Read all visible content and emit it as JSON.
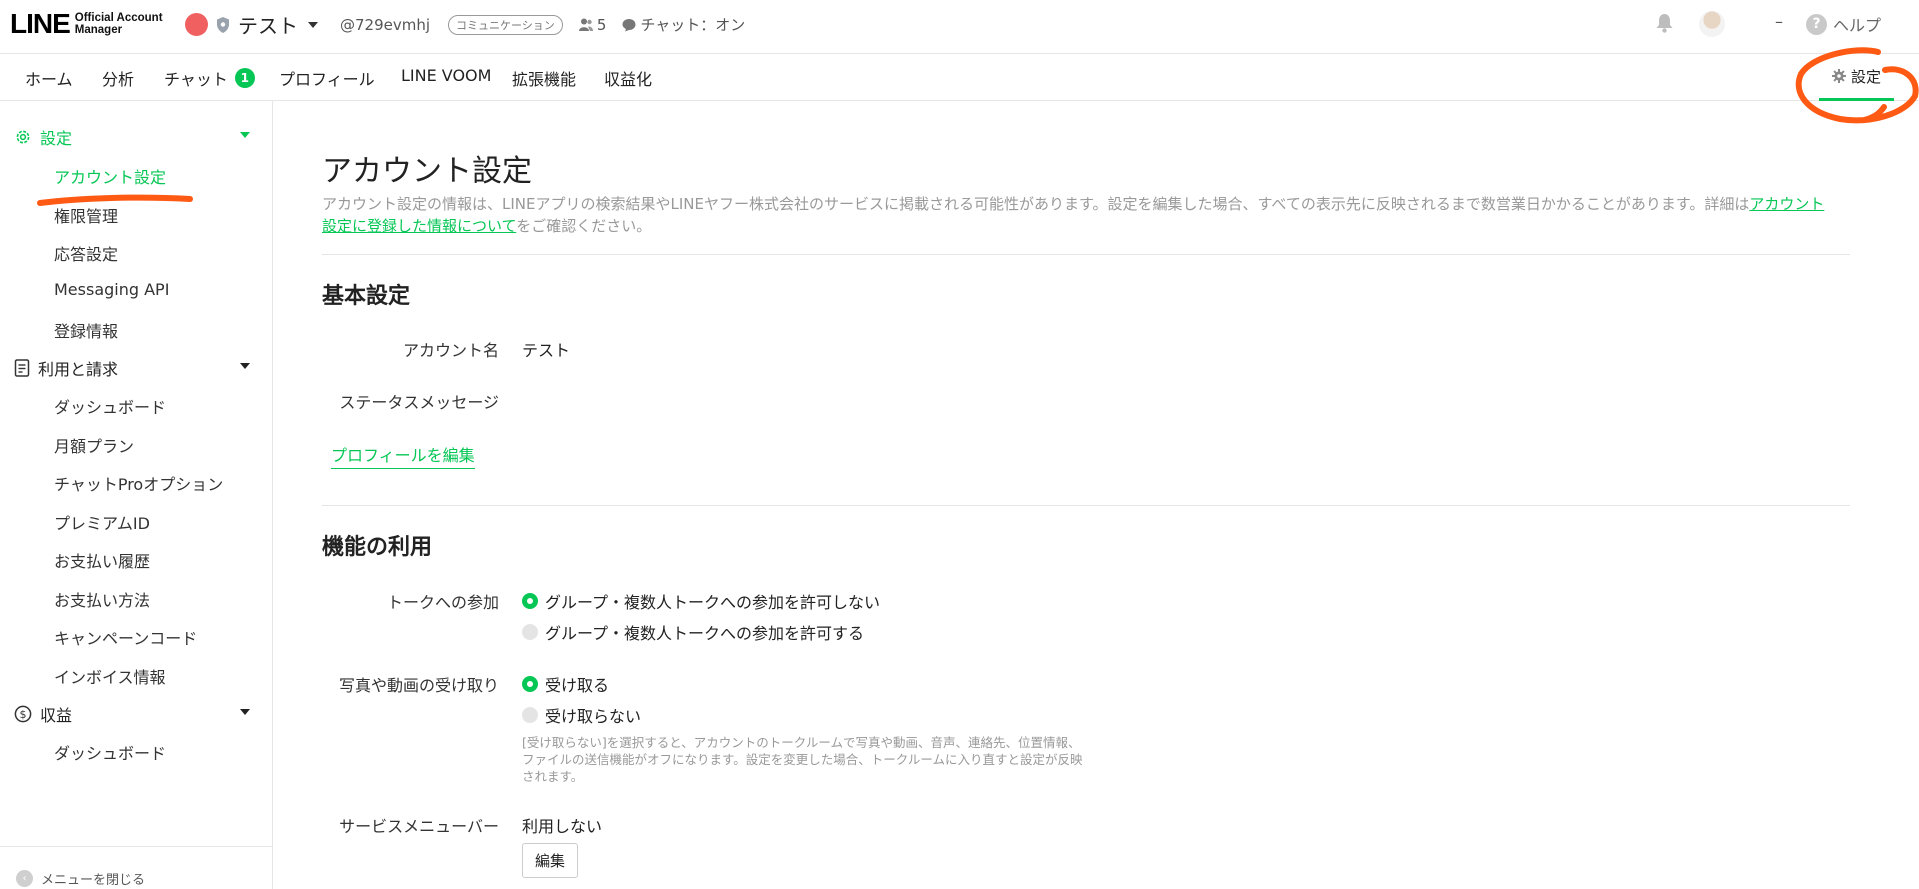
{
  "header": {
    "logo_main": "LINE",
    "logo_sub": "Official Account Manager",
    "account_name": "テスト",
    "account_id": "@729evmhj",
    "plan_badge": "コミュニケーション",
    "friends_count": "5",
    "chat_status": "チャット：オン",
    "dash": "–",
    "help_label": "ヘルプ"
  },
  "nav": {
    "tabs": [
      "ホーム",
      "分析",
      "チャット",
      "プロフィール",
      "LINE VOOM",
      "拡張機能",
      "収益化"
    ],
    "chat_badge": "1",
    "settings_label": "設定"
  },
  "sidebar": {
    "sections": [
      {
        "label": "設定",
        "items": [
          "アカウント設定",
          "権限管理",
          "応答設定",
          "Messaging API",
          "登録情報"
        ]
      },
      {
        "label": "利用と請求",
        "items": [
          "ダッシュボード",
          "月額プラン",
          "チャットProオプション",
          "プレミアムID",
          "お支払い履歴",
          "お支払い方法",
          "キャンペーンコード",
          "インボイス情報"
        ]
      },
      {
        "label": "収益",
        "items": [
          "ダッシュボード"
        ]
      }
    ],
    "close_menu": "メニューを閉じる"
  },
  "main": {
    "title": "アカウント設定",
    "desc_before": "アカウント設定の情報は、LINEアプリの検索結果やLINEヤフー株式会社のサービスに掲載される可能性があります。設定を編集した場合、すべての表示先に反映されるまで数営業日かかることがあります。詳細は",
    "desc_link": "アカウント設定に登録した情報について",
    "desc_after": "をご確認ください。",
    "basic": {
      "title": "基本設定",
      "account_name_label": "アカウント名",
      "account_name_value": "テスト",
      "status_label": "ステータスメッセージ",
      "edit_profile": "プロフィールを編集"
    },
    "features": {
      "title": "機能の利用",
      "talk_label": "トークへの参加",
      "talk_options": [
        "グループ・複数人トークへの参加を許可しない",
        "グループ・複数人トークへの参加を許可する"
      ],
      "media_label": "写真や動画の受け取り",
      "media_options": [
        "受け取る",
        "受け取らない"
      ],
      "media_note": "[受け取らない]を選択すると、アカウントのトークルームで写真や動画、音声、連絡先、位置情報、ファイルの送信機能がオフになります。設定を変更した場合、トークルームに入り直すと設定が反映されます。",
      "service_label": "サービスメニューバー",
      "service_value": "利用しない",
      "edit_button": "編集"
    }
  },
  "colors": {
    "accent": "#06c755",
    "annotation": "#ff5a14"
  }
}
